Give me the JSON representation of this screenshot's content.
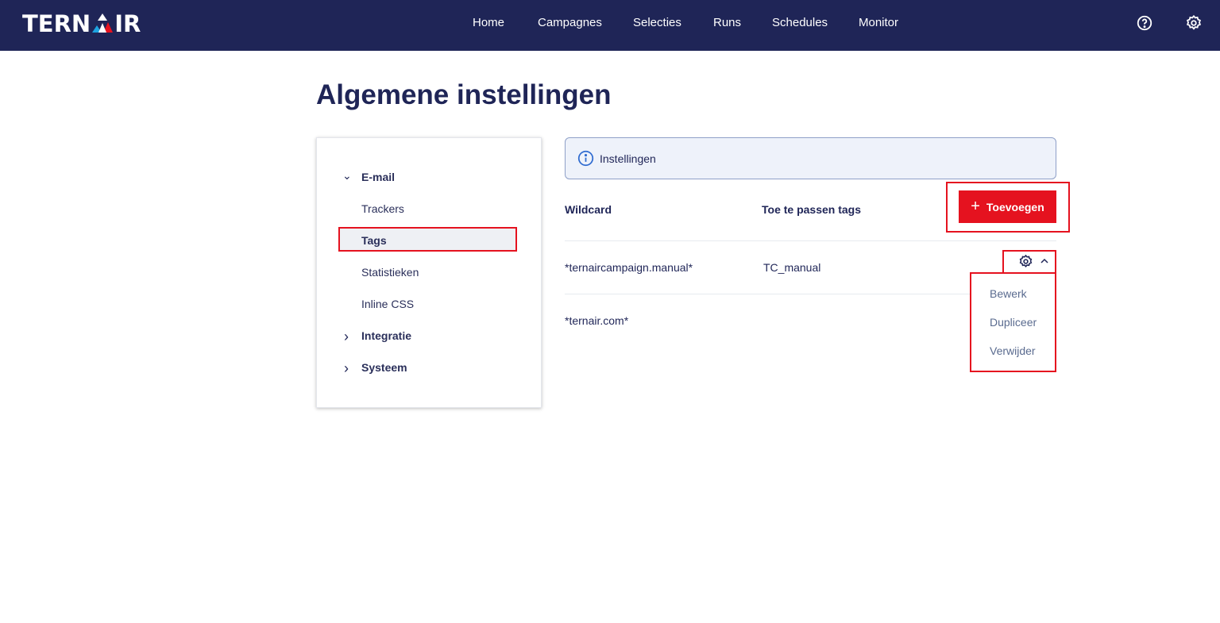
{
  "header": {
    "logo": "TERNAIR",
    "nav": [
      "Home",
      "Campagnes",
      "Selecties",
      "Runs",
      "Schedules",
      "Monitor"
    ]
  },
  "page": {
    "title": "Algemene instellingen"
  },
  "sidebar": {
    "email": "E-mail",
    "items": [
      "Trackers",
      "Tags",
      "Statistieken",
      "Inline CSS"
    ],
    "integratie": "Integratie",
    "systeem": "Systeem"
  },
  "info": {
    "label": "Instellingen"
  },
  "table": {
    "headers": [
      "Wildcard",
      "Toe te passen tags"
    ],
    "add_label": "Toevoegen",
    "rows": [
      {
        "wildcard": "*ternaircampaign.manual*",
        "tags": "TC_manual"
      },
      {
        "wildcard": "*ternair.com*",
        "tags": ""
      }
    ]
  },
  "menu": {
    "items": [
      "Bewerk",
      "Dupliceer",
      "Verwijder"
    ]
  }
}
